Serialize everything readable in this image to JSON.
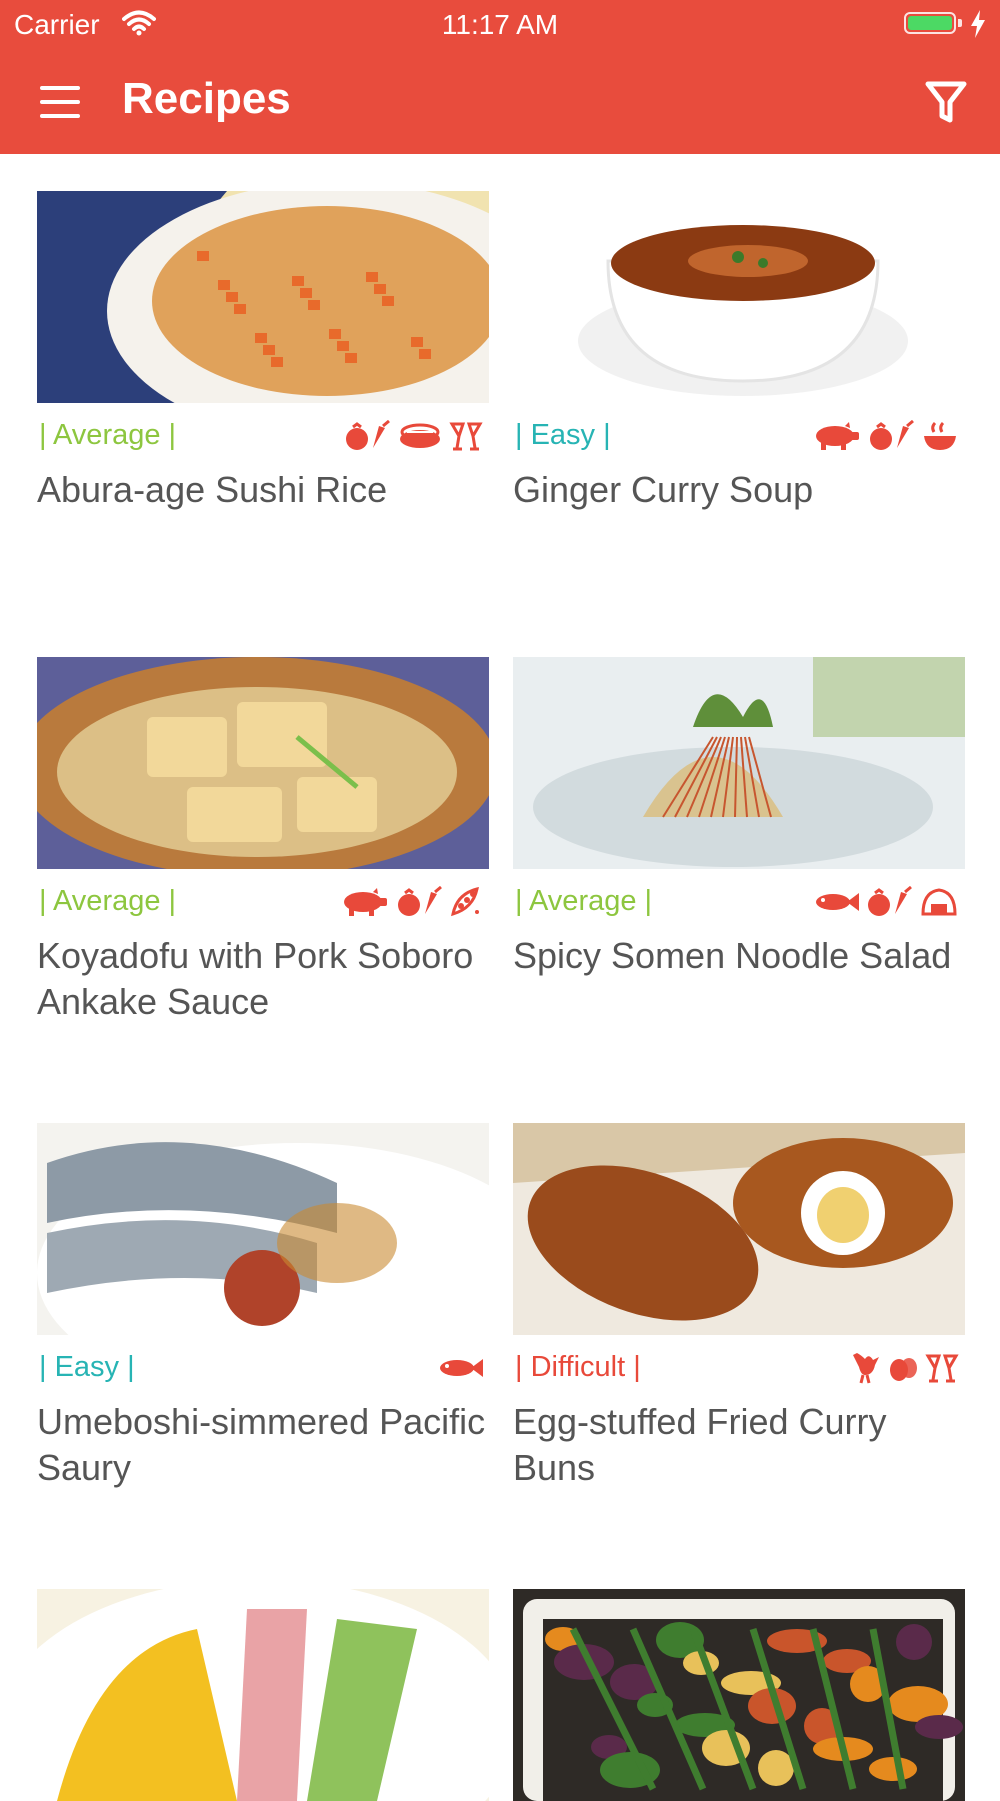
{
  "status_bar": {
    "carrier": "Carrier",
    "time": "11:17 AM",
    "battery_color": "#4cd964"
  },
  "nav": {
    "title": "Recipes",
    "menu_icon": "hamburger-menu-icon",
    "filter_icon": "filter-icon"
  },
  "colors": {
    "brand": "#e84c3d",
    "average": "#8dc63f",
    "easy": "#27b4b4",
    "difficult": "#e8493a",
    "icon": "#e8493a"
  },
  "recipes": [
    {
      "name": "Abura-age Sushi Rice",
      "difficulty": "| Average |",
      "difficulty_color": "#8dc63f",
      "tag_icons": [
        "vegetables-icon",
        "sushi-icon",
        "celebration-glasses-icon"
      ],
      "photo_desc": "rice-dish-photo",
      "palette": [
        "#f1e3b0",
        "#2c3f7a",
        "#e0a25b",
        "#f5f2ec"
      ]
    },
    {
      "name": "Ginger Curry Soup",
      "difficulty": "| Easy |",
      "difficulty_color": "#27b4b4",
      "tag_icons": [
        "pig-icon",
        "vegetables-icon",
        "hot-pot-icon"
      ],
      "photo_desc": "soup-bowl-photo",
      "palette": [
        "#ffffff",
        "#f1f1f1",
        "#8b3a12",
        "#c0652d"
      ]
    },
    {
      "name": "Koyadofu with Pork Soboro Ankake Sauce",
      "difficulty": "| Average |",
      "difficulty_color": "#8dc63f",
      "tag_icons": [
        "pig-icon",
        "vegetables-icon",
        "beans-icon"
      ],
      "photo_desc": "tofu-dish-photo",
      "palette": [
        "#5d5f99",
        "#b97a3d",
        "#f2d89a",
        "#dcbf86"
      ]
    },
    {
      "name": "Spicy Somen Noodle Salad",
      "difficulty": "| Average |",
      "difficulty_color": "#8dc63f",
      "tag_icons": [
        "fish-icon",
        "vegetables-icon",
        "rice-ball-icon"
      ],
      "photo_desc": "noodle-salad-photo",
      "palette": [
        "#e9eef0",
        "#cfd8dc",
        "#d9c38f",
        "#5f8f3a"
      ]
    },
    {
      "name": "Umeboshi-simmered Pacific Saury",
      "difficulty": "| Easy |",
      "difficulty_color": "#27b4b4",
      "tag_icons": [
        "fish-icon"
      ],
      "photo_desc": "saury-fish-photo",
      "palette": [
        "#f4f3ef",
        "#8d9aa6",
        "#c98a32",
        "#b0432a"
      ]
    },
    {
      "name": "Egg-stuffed Fried Curry Buns",
      "difficulty": "| Difficult |",
      "difficulty_color": "#e8493a",
      "tag_icons": [
        "chicken-icon",
        "egg-icon",
        "celebration-glasses-icon"
      ],
      "photo_desc": "curry-buns-photo",
      "palette": [
        "#d9c7a7",
        "#9a4b1c",
        "#f0d070",
        "#efe9df"
      ]
    },
    {
      "name": "",
      "difficulty": "",
      "difficulty_color": "#8dc63f",
      "tag_icons": [],
      "photo_desc": "cold-noodles-photo",
      "palette": [
        "#f7f2e2",
        "#f3c021",
        "#e9a3a6",
        "#8fc25c"
      ]
    },
    {
      "name": "",
      "difficulty": "",
      "difficulty_color": "#8dc63f",
      "tag_icons": [],
      "photo_desc": "roasted-vegetables-photo",
      "palette": [
        "#2e2a26",
        "#3f7d2f",
        "#e58a1e",
        "#5a2a4a"
      ]
    }
  ]
}
